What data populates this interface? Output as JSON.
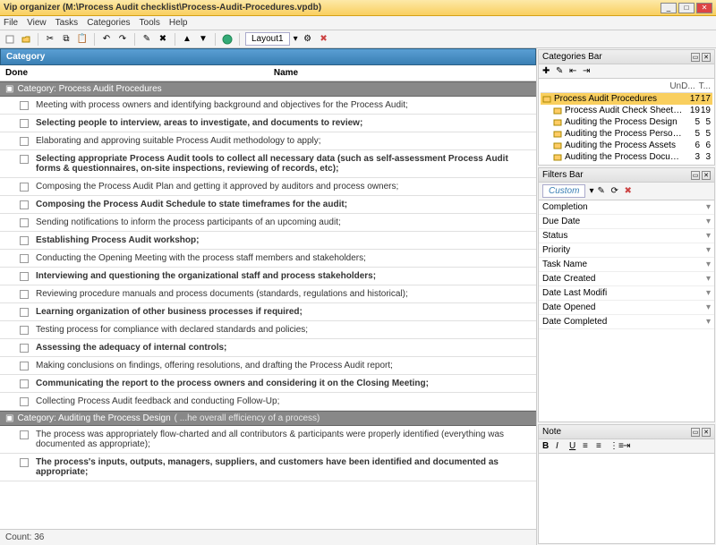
{
  "window": {
    "title": "Vip organizer (M:\\Process Audit checklist\\Process-Audit-Procedures.vpdb)"
  },
  "menu": [
    "File",
    "View",
    "Tasks",
    "Categories",
    "Tools",
    "Help"
  ],
  "toolbar": {
    "layout": "Layout1"
  },
  "grid": {
    "header": "Category",
    "col_done": "Done",
    "col_name": "Name",
    "group1": "Category: Process Audit Procedures",
    "group2_a": "Category: Auditing the Process Design",
    "group2_b": "( ...he overall efficiency of a process)",
    "count": "Count: 36"
  },
  "tasks1": [
    {
      "text": "Meeting with process owners and identifying background and objectives for the Process Audit;",
      "bold": false
    },
    {
      "text": "Selecting people to interview, areas to investigate, and documents to review;",
      "bold": true
    },
    {
      "text": "Elaborating and approving suitable Process Audit methodology to apply;",
      "bold": false
    },
    {
      "text": "Selecting appropriate Process Audit tools to collect all necessary data (such as self-assessment Process Audit forms & questionnaires, on-site inspections, reviewing of records, etc);",
      "bold": true
    },
    {
      "text": "Composing the Process Audit Plan and getting it approved by auditors and process owners;",
      "bold": false
    },
    {
      "text": "Composing the Process Audit Schedule to state timeframes for the audit;",
      "bold": true
    },
    {
      "text": "Sending notifications to inform the process participants of an upcoming audit;",
      "bold": false
    },
    {
      "text": "Establishing Process Audit workshop;",
      "bold": true
    },
    {
      "text": "Conducting the Opening Meeting with the process staff members and stakeholders;",
      "bold": false
    },
    {
      "text": "Interviewing and questioning the organizational staff and process stakeholders;",
      "bold": true
    },
    {
      "text": "Reviewing procedure manuals and process documents (standards, regulations and historical);",
      "bold": false
    },
    {
      "text": "Learning organization of other business processes if required;",
      "bold": true
    },
    {
      "text": "Testing process for compliance with declared standards and policies;",
      "bold": false
    },
    {
      "text": "Assessing the adequacy of internal controls;",
      "bold": true
    },
    {
      "text": "Making conclusions on findings, offering resolutions, and drafting the Process Audit report;",
      "bold": false
    },
    {
      "text": "Communicating the report to the process owners and considering it on the Closing Meeting;",
      "bold": true
    },
    {
      "text": "Collecting Process Audit feedback and conducting Follow-Up;",
      "bold": false
    }
  ],
  "tasks2": [
    {
      "text": "The process was appropriately flow-charted and all contributors & participants were properly identified (everything was documented as appropriate);",
      "bold": false
    },
    {
      "text": "The process's inputs, outputs, managers, suppliers, and customers have been identified and documented as appropriate;",
      "bold": true
    }
  ],
  "categoriesBar": {
    "title": "Categories Bar",
    "col1": "UnD...",
    "col2": "T...",
    "items": [
      {
        "label": "Process Audit Procedures",
        "n1": "17",
        "n2": "17",
        "sel": true,
        "depth": 0
      },
      {
        "label": "Process Audit Check Sheet (inspecting the",
        "n1": "19",
        "n2": "19",
        "sel": false,
        "depth": 1
      },
      {
        "label": "Auditing the Process Design",
        "n1": "5",
        "n2": "5",
        "sel": false,
        "depth": 1
      },
      {
        "label": "Auditing the Process Personnel",
        "n1": "5",
        "n2": "5",
        "sel": false,
        "depth": 1
      },
      {
        "label": "Auditing the Process Assets",
        "n1": "6",
        "n2": "6",
        "sel": false,
        "depth": 1
      },
      {
        "label": "Auditing the Process Documentation",
        "n1": "3",
        "n2": "3",
        "sel": false,
        "depth": 1
      }
    ]
  },
  "filtersBar": {
    "title": "Filters Bar",
    "tab": "Custom",
    "items": [
      "Completion",
      "Due Date",
      "Status",
      "Priority",
      "Task Name",
      "Date Created",
      "Date Last Modifi",
      "Date Opened",
      "Date Completed"
    ]
  },
  "notePanel": {
    "title": "Note"
  }
}
